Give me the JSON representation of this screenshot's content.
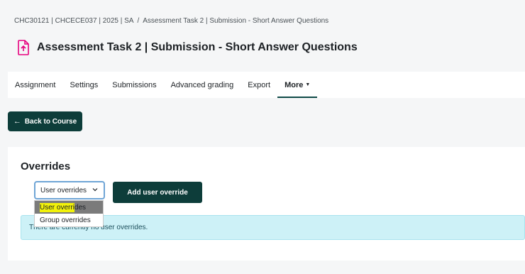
{
  "breadcrumb": {
    "course": "CHC30121 | CHCECE037 | 2025 | SA",
    "separator": "/",
    "current": "Assessment Task 2 | Submission - Short Answer Questions"
  },
  "page": {
    "title": "Assessment Task 2 | Submission - Short Answer Questions",
    "icon": "assignment-upload-icon"
  },
  "tabs": [
    {
      "label": "Assignment"
    },
    {
      "label": "Settings"
    },
    {
      "label": "Submissions"
    },
    {
      "label": "Advanced grading"
    },
    {
      "label": "Export"
    },
    {
      "label": "More",
      "active": true
    }
  ],
  "back_button": {
    "label": "Back to Course"
  },
  "overrides": {
    "title": "Overrides",
    "select_value": "User overrides",
    "options": [
      {
        "label_highlighted": "User overri",
        "label_rest": "des"
      },
      {
        "label": "Group overrides"
      }
    ],
    "add_button": "Add user override",
    "notice": "There are currently no user overrides."
  },
  "colors": {
    "primary": "#0d3d3a",
    "accent_icon": "#e6007e",
    "notice_bg": "#cdf1f7",
    "highlight": "#f2f20a"
  }
}
